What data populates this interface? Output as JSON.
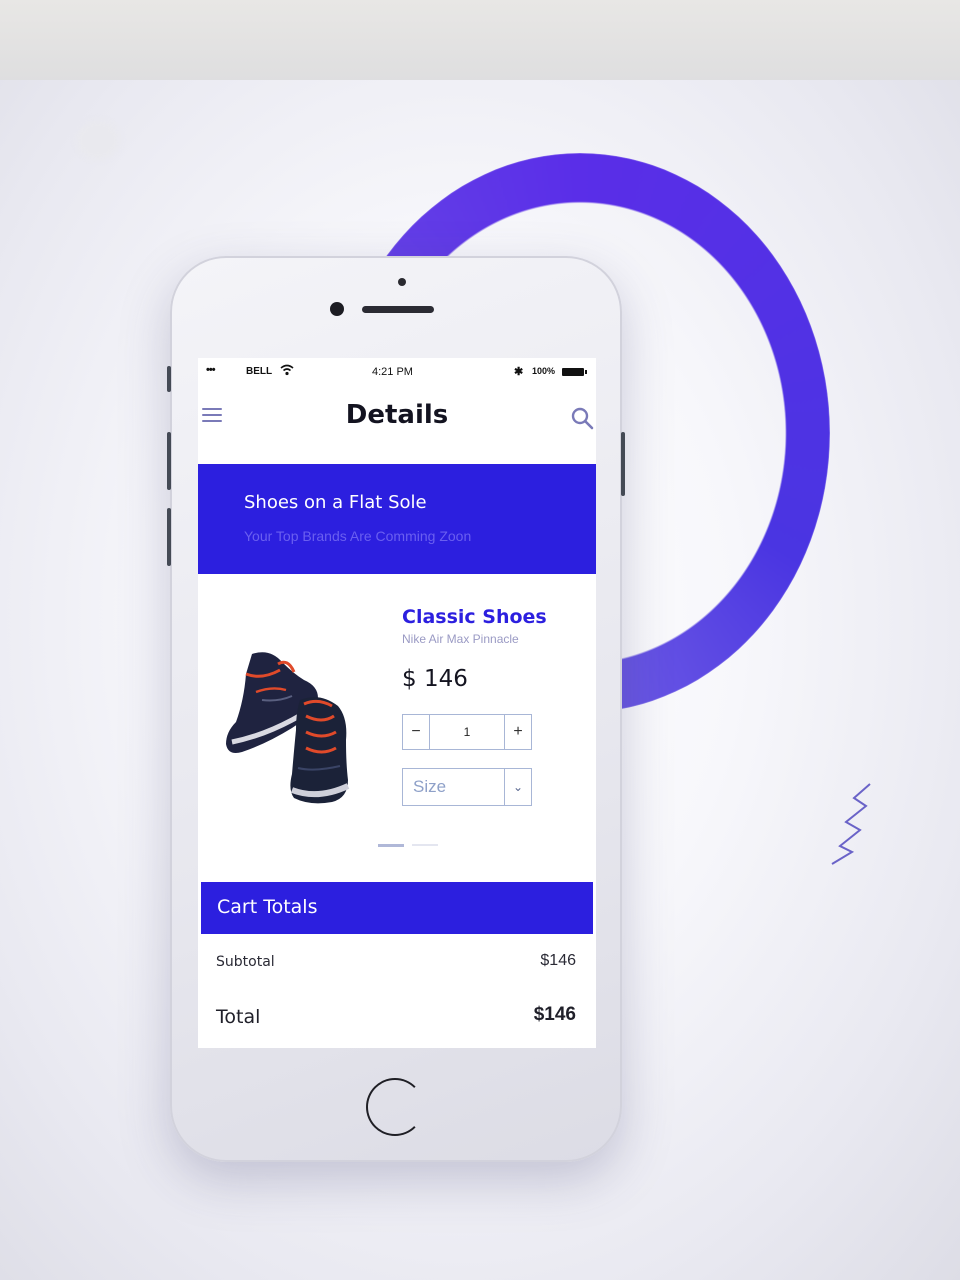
{
  "status_bar": {
    "signal": "•••",
    "carrier": "BELL",
    "time": "4:21 PM",
    "battery": "100%",
    "icons": [
      "wifi-icon",
      "bluetooth-icon",
      "battery-icon"
    ]
  },
  "nav": {
    "title": "Details",
    "left_icon": "menu-icon",
    "right_icon": "search-icon"
  },
  "banner": {
    "title": "Shoes on a Flat Sole",
    "subtitle": "Your Top Brands Are Comming Zoon"
  },
  "product": {
    "name": "Classic Shoes",
    "model": "Nike Air Max Pinnacle",
    "price": "$ 146",
    "quantity": "1",
    "minus_label": "−",
    "plus_label": "+",
    "size_placeholder": "Size",
    "size_arrow": "⌄"
  },
  "cart": {
    "title": "Cart Totals",
    "subtotal_label": "Subtotal",
    "subtotal_value": "$146",
    "total_label": "Total",
    "total_value": "$146"
  },
  "colors": {
    "accent": "#2c1fdf",
    "ring": "#5a2ee8",
    "text_dark": "#131320"
  }
}
